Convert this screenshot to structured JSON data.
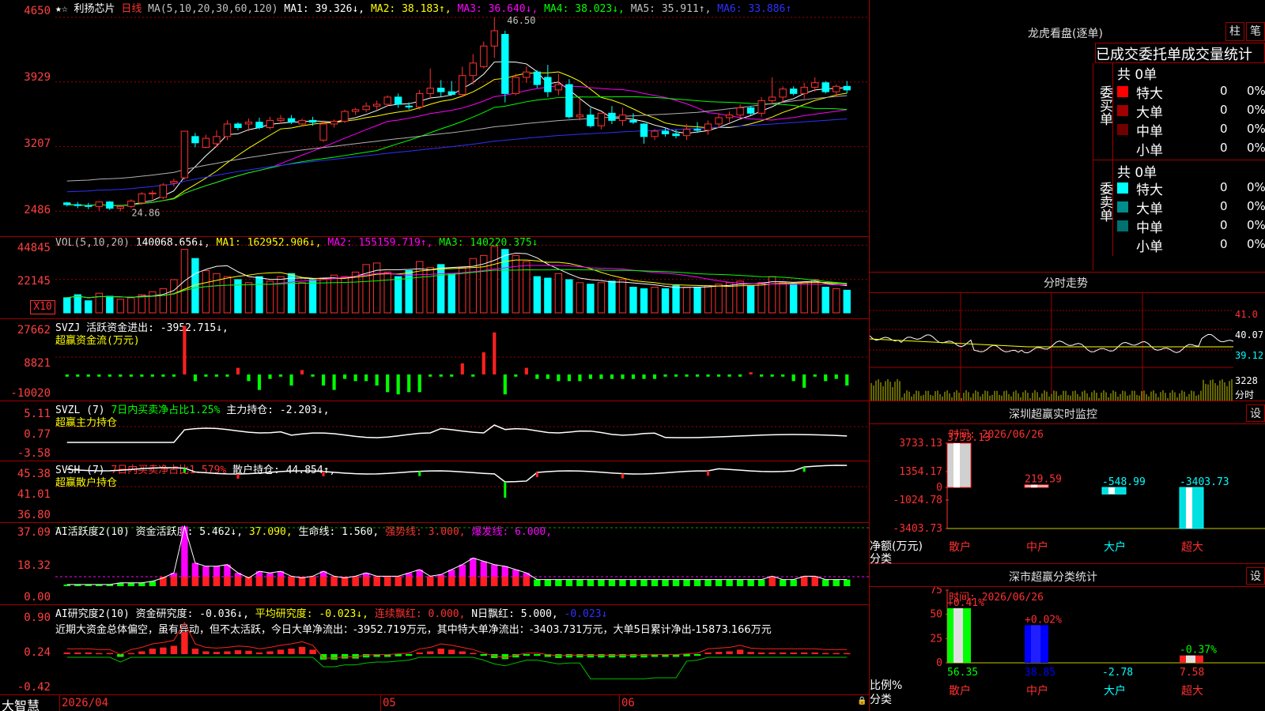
{
  "title_bar": {
    "stars": "★☆",
    "stock_name": "利扬芯片",
    "period": "日线",
    "ma_label": "MA(5,10,20,30,60,120)",
    "ma1": "MA1: 39.326↓,",
    "ma2": "MA2: 38.183↑,",
    "ma3": "MA3: 36.640↓,",
    "ma4": "MA4: 38.023↓,",
    "ma5": "MA5: 35.911↑,",
    "ma6": "MA6: 33.886↑"
  },
  "price_axis": [
    "4650",
    "3929",
    "3207",
    "2486"
  ],
  "price_high": "46.50",
  "price_low": "24.86",
  "vol": {
    "header": "VOL(5,10,20)",
    "value": "140068.656↓,",
    "ma1": "MA1: 162952.906↓,",
    "ma2": "MA2: 155159.719↑,",
    "ma3": "MA3: 140220.375↓",
    "axis": [
      "44845",
      "22145"
    ],
    "unit": "X10"
  },
  "svzj": {
    "header": "SVZJ",
    "desc": "活跃资金进出: -3952.715↓,",
    "sub": "超赢资金流(万元)",
    "axis": [
      "27662",
      "8821",
      "-10020"
    ]
  },
  "svzl": {
    "header": "SVZL (7)",
    "desc1": "7日内买卖净占比1.25%",
    "desc2": "主力持仓: -2.203↓,",
    "sub": "超赢主力持仓",
    "axis": [
      "5.11",
      "0.77",
      "-3.58"
    ]
  },
  "svsh": {
    "header": "SVSH (7)",
    "desc1": "7日内买卖净占比1.579%",
    "desc2": "散户持仓: 44.854↑,",
    "sub": "超赢散户持仓",
    "axis": [
      "45.38",
      "41.01",
      "36.80"
    ]
  },
  "ai1": {
    "header": "AI活跃度2(10)",
    "desc1": "资金活跃度: 5.462↓,",
    "desc2": "37.090,",
    "desc3": "生命线: 1.560,",
    "desc4": "强势线: 3.000,",
    "desc5": "爆发线: 6.000,",
    "axis": [
      "37.09",
      "18.32",
      "0.00"
    ]
  },
  "ai2": {
    "header": "AI研究度2(10)",
    "desc1": "资金研究度: -0.036↓,",
    "desc2": "平均研究度: -0.023↓,",
    "desc3": "连续飘红: 0.000,",
    "desc4": "N日飘红: 5.000,",
    "desc5": "-0.023↓",
    "summary": "近期大资金总体偏空，虽有异动，但不太活跃，今日大单净流出：-3952.719万元，其中特大单净流出：-3403.731万元，大单5日累计净出-15873.166万元",
    "axis": [
      "0.90",
      "0.24",
      "-0.42"
    ]
  },
  "bottom": {
    "brand": "大智慧",
    "date_start": "2026/04",
    "m05": "05",
    "m06": "06"
  },
  "dragon": {
    "title": "龙虎看盘(逐单)",
    "btn1": "柱",
    "btn2": "笔",
    "tab_header": "已成交委托单成交量统计",
    "buy_label": "委买单",
    "sell_label": "委卖单",
    "buy_total": "共 0单",
    "sell_total": "共 0单",
    "buy_rows": [
      {
        "name": "特大",
        "count": "0",
        "pct": "0%",
        "color": "#ff0000"
      },
      {
        "name": "大单",
        "count": "0",
        "pct": "0%",
        "color": "#a00000"
      },
      {
        "name": "中单",
        "count": "0",
        "pct": "0%",
        "color": "#700000"
      },
      {
        "name": "小单",
        "count": "0",
        "pct": "0%",
        "color": ""
      }
    ],
    "sell_rows": [
      {
        "name": "特大",
        "count": "0",
        "pct": "0%",
        "color": "#00ffff"
      },
      {
        "name": "大单",
        "count": "0",
        "pct": "0%",
        "color": "#008c8c"
      },
      {
        "name": "中单",
        "count": "0",
        "pct": "0%",
        "color": "#007070"
      },
      {
        "name": "小单",
        "count": "0",
        "pct": "0%",
        "color": ""
      }
    ]
  },
  "intraday": {
    "title": "分时走势",
    "axis": [
      "41.0",
      "40.07",
      "39.12"
    ],
    "vol_axis": [
      "3228",
      "分时"
    ]
  },
  "monitor": {
    "title": "深圳超赢实时监控",
    "set": "设",
    "time": "时间: 2026/06/26",
    "axis": [
      "3733.13",
      "1354.17",
      "0",
      "-1024.78",
      "-3403.73"
    ],
    "ylabel1": "净额(万元)",
    "ylabel2": "分类",
    "bars": [
      {
        "cat": "散户",
        "value": 3733.13,
        "label": "3733.13"
      },
      {
        "cat": "中户",
        "value": 219.59,
        "label": "219.59"
      },
      {
        "cat": "大户",
        "value": -548.99,
        "label": "-548.99"
      },
      {
        "cat": "超大",
        "value": -3403.73,
        "label": "-3403.73"
      }
    ]
  },
  "classify": {
    "title": "深市超赢分类统计",
    "set": "设",
    "time": "时间: 2026/06/26",
    "axis": [
      "75",
      "50",
      "25",
      "0"
    ],
    "ylabel1": "比例%",
    "ylabel2": "分类",
    "bars": [
      {
        "cat": "散户",
        "value": 56.35,
        "label": "56.35",
        "change": "+0.41%"
      },
      {
        "cat": "中户",
        "value": 38.85,
        "label": "38.85",
        "change": "+0.02%"
      },
      {
        "cat": "大户",
        "value": -2.78,
        "label": "-2.78",
        "change": ""
      },
      {
        "cat": "超大",
        "value": 7.58,
        "label": "7.58",
        "change": "-0.37%"
      }
    ]
  },
  "chart_data": {
    "type": "candlestick",
    "candles": [
      [
        25.8,
        25.9,
        25.4,
        25.6
      ],
      [
        25.6,
        25.9,
        25.2,
        25.5
      ],
      [
        25.5,
        25.8,
        25.1,
        25.4
      ],
      [
        25.4,
        25.8,
        24.9,
        25.9
      ],
      [
        25.9,
        26.0,
        25.0,
        25.2
      ],
      [
        25.2,
        25.6,
        24.86,
        25.4
      ],
      [
        25.4,
        26.2,
        25.2,
        26.0
      ],
      [
        25.8,
        27.0,
        25.6,
        26.8
      ],
      [
        26.8,
        27.2,
        26.2,
        26.9
      ],
      [
        26.4,
        28.0,
        26.2,
        27.8
      ],
      [
        28.0,
        28.5,
        27.6,
        28.2
      ],
      [
        28.6,
        33.8,
        28.4,
        33.8
      ],
      [
        33.2,
        33.6,
        32.0,
        32.5
      ],
      [
        32.0,
        33.4,
        31.9,
        33.0
      ],
      [
        32.4,
        33.9,
        32.0,
        33.2
      ],
      [
        33.2,
        35.0,
        32.8,
        34.6
      ],
      [
        34.6,
        34.8,
        33.9,
        34.2
      ],
      [
        34.6,
        35.2,
        33.8,
        34.8
      ],
      [
        34.8,
        35.3,
        34.0,
        34.2
      ],
      [
        34.2,
        35.4,
        34.0,
        35.0
      ],
      [
        35.0,
        35.6,
        34.6,
        35.2
      ],
      [
        35.2,
        35.6,
        34.6,
        34.8
      ],
      [
        34.6,
        35.2,
        34.4,
        35.0
      ],
      [
        35.0,
        35.4,
        34.4,
        34.8
      ],
      [
        32.8,
        35.0,
        32.6,
        34.6
      ],
      [
        34.6,
        35.1,
        34.2,
        34.9
      ],
      [
        34.9,
        36.2,
        34.7,
        36.0
      ],
      [
        36.0,
        36.4,
        35.6,
        36.2
      ],
      [
        36.2,
        37.0,
        35.9,
        36.6
      ],
      [
        36.6,
        37.2,
        36.2,
        36.8
      ],
      [
        36.8,
        37.8,
        36.6,
        37.6
      ],
      [
        37.6,
        38.0,
        36.4,
        36.8
      ],
      [
        36.6,
        37.0,
        36.2,
        36.5
      ],
      [
        36.5,
        38.4,
        36.2,
        38.0
      ],
      [
        38.0,
        40.8,
        37.4,
        38.6
      ],
      [
        38.6,
        39.5,
        37.6,
        38.2
      ],
      [
        38.2,
        39.4,
        37.8,
        37.9
      ],
      [
        37.9,
        41.0,
        37.6,
        40.0
      ],
      [
        40.0,
        42.4,
        39.0,
        41.4
      ],
      [
        41.0,
        43.8,
        40.8,
        43.3
      ],
      [
        43.3,
        46.5,
        42.0,
        45.0
      ],
      [
        44.6,
        45.0,
        37.0,
        38.0
      ],
      [
        38.0,
        40.2,
        37.8,
        39.8
      ],
      [
        39.8,
        41.0,
        39.2,
        40.4
      ],
      [
        40.4,
        40.6,
        38.6,
        39.0
      ],
      [
        39.8,
        41.2,
        37.6,
        38.2
      ],
      [
        38.4,
        40.2,
        37.8,
        39.0
      ],
      [
        39.0,
        39.6,
        35.2,
        35.4
      ],
      [
        35.4,
        37.6,
        35.0,
        35.6
      ],
      [
        35.6,
        36.4,
        34.2,
        34.4
      ],
      [
        34.4,
        35.8,
        34.0,
        35.8
      ],
      [
        35.8,
        36.6,
        34.6,
        35.0
      ],
      [
        35.0,
        36.4,
        34.4,
        35.6
      ],
      [
        35.0,
        35.8,
        34.6,
        34.8
      ],
      [
        34.6,
        34.7,
        32.4,
        33.2
      ],
      [
        33.2,
        34.0,
        32.8,
        33.8
      ],
      [
        33.8,
        34.2,
        33.2,
        33.5
      ],
      [
        33.5,
        34.0,
        33.0,
        33.3
      ],
      [
        33.3,
        34.6,
        32.8,
        34.0
      ],
      [
        34.0,
        34.8,
        33.6,
        33.9
      ],
      [
        33.9,
        35.0,
        33.4,
        34.6
      ],
      [
        34.6,
        35.8,
        34.2,
        35.3
      ],
      [
        35.3,
        36.0,
        34.8,
        35.6
      ],
      [
        35.6,
        36.8,
        35.2,
        36.4
      ],
      [
        36.4,
        36.6,
        35.6,
        35.8
      ],
      [
        35.8,
        37.6,
        35.4,
        37.2
      ],
      [
        37.2,
        39.8,
        36.8,
        37.6
      ],
      [
        37.6,
        38.8,
        37.0,
        38.5
      ],
      [
        38.5,
        38.8,
        37.8,
        38.0
      ],
      [
        38.0,
        39.2,
        37.4,
        38.7
      ],
      [
        38.7,
        39.8,
        38.2,
        39.2
      ],
      [
        39.2,
        39.4,
        38.0,
        38.2
      ],
      [
        38.2,
        39.0,
        37.6,
        38.8
      ],
      [
        38.8,
        39.4,
        38.0,
        38.4
      ]
    ],
    "volume": [
      10,
      12,
      8,
      13,
      11,
      9,
      10,
      12,
      14,
      16,
      22,
      42,
      36,
      28,
      26,
      24,
      22,
      20,
      24,
      21,
      24,
      26,
      20,
      22,
      23,
      25,
      24,
      27,
      32,
      33,
      27,
      24,
      28,
      34,
      30,
      32,
      26,
      30,
      36,
      38,
      44,
      42,
      38,
      34,
      24,
      23,
      26,
      22,
      20,
      19,
      20,
      21,
      22,
      17,
      16,
      17,
      16,
      18,
      17,
      17,
      18,
      19,
      20,
      21,
      18,
      20,
      24,
      20,
      19,
      20,
      22,
      17,
      16,
      15
    ],
    "svzj": [
      -1,
      -1,
      -1,
      -1,
      -1,
      -1,
      -1,
      -1,
      -1,
      -1,
      -1,
      22,
      -3,
      -1,
      -1,
      -1,
      3,
      -3,
      -7,
      -2,
      -1,
      -5,
      2,
      -1,
      -5,
      -7,
      -2,
      -3,
      -3,
      -5,
      -8,
      -9,
      -8,
      -8,
      -1,
      -1,
      -1,
      5,
      -1,
      10,
      19,
      -9,
      -1,
      3,
      -2,
      -2,
      -3,
      -3,
      -3,
      -2,
      -2,
      -2,
      -2,
      -2,
      -2,
      -2,
      -1,
      -1,
      -1,
      -1,
      -1,
      -1,
      -1,
      -1,
      1,
      -1,
      -1,
      -1,
      -3,
      -6,
      -1,
      -3,
      -2,
      -5
    ],
    "period": "日线"
  }
}
